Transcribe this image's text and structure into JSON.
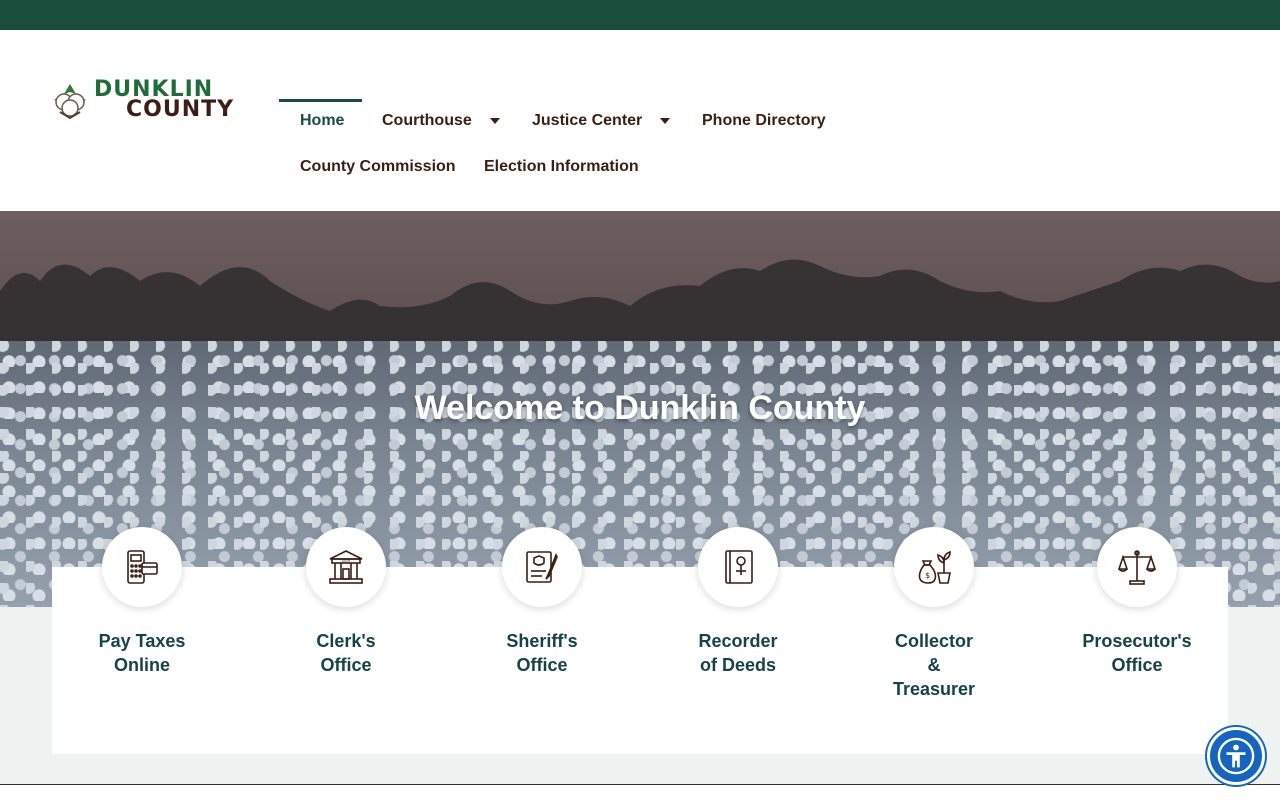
{
  "header": {
    "logo": {
      "line1": "DUNKLIN",
      "line2": "COUNTY",
      "icon": "cotton-boll-icon"
    },
    "nav": [
      {
        "label": "Home",
        "active": true,
        "has_dropdown": false
      },
      {
        "label": "Courthouse",
        "active": false,
        "has_dropdown": true
      },
      {
        "label": "Justice Center",
        "active": false,
        "has_dropdown": true
      },
      {
        "label": "Phone Directory",
        "active": false,
        "has_dropdown": false
      },
      {
        "label": "County Commission",
        "active": false,
        "has_dropdown": false
      },
      {
        "label": "Election Information",
        "active": false,
        "has_dropdown": false
      }
    ]
  },
  "hero": {
    "title": "Welcome to Dunklin County"
  },
  "services": [
    {
      "label": "Pay Taxes\nOnline",
      "icon": "payment-terminal-icon"
    },
    {
      "label": "Clerk's\nOffice",
      "icon": "government-building-icon"
    },
    {
      "label": "Sheriff's\nOffice",
      "icon": "badge-document-icon"
    },
    {
      "label": "Recorder\nof Deeds",
      "icon": "record-book-icon"
    },
    {
      "label": "Collector\n&\nTreasurer",
      "icon": "money-bag-plant-icon"
    },
    {
      "label": "Prosecutor's\nOffice",
      "icon": "scales-of-justice-icon"
    }
  ],
  "accessibility": {
    "icon": "accessibility-icon"
  },
  "colors": {
    "top_bar": "#1a4d3c",
    "brand_green": "#1f6b3a",
    "brand_brown": "#3a1f12",
    "service_text": "#16424a",
    "accessibility_blue": "#1565c0"
  }
}
